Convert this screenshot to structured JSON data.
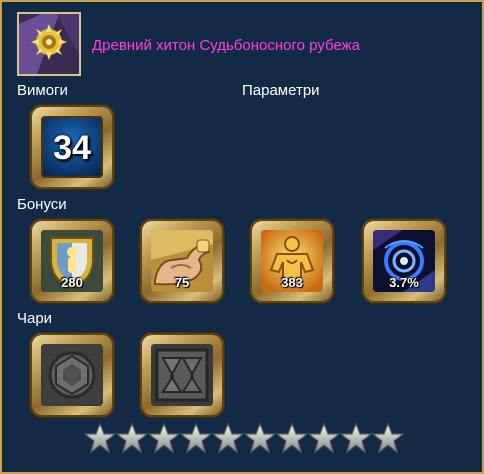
{
  "item": {
    "name": "Древний хитон Судьбоносного рубежа",
    "icon": "ancient-robe-icon"
  },
  "sections": {
    "requirements_label": "Вимоги",
    "parameters_label": "Параметри",
    "bonuses_label": "Бонуси",
    "charms_label": "Чари"
  },
  "requirement": {
    "level": "34",
    "icon": "level-requirement-icon"
  },
  "bonuses": [
    {
      "icon": "shield-defense-icon",
      "value": "280"
    },
    {
      "icon": "strength-arm-icon",
      "value": "75"
    },
    {
      "icon": "stamina-body-icon",
      "value": "383"
    },
    {
      "icon": "blue-vortex-icon",
      "value": "3.7%"
    }
  ],
  "charms": [
    {
      "icon": "empty-charm-slot-icon"
    },
    {
      "icon": "empty-charm-slot-icon"
    }
  ],
  "rating": {
    "stars_filled": 0,
    "stars_total": 10
  },
  "colors": {
    "background": "#132a47",
    "border": "#c9a44a",
    "item_name": "#ff3fe0",
    "label": "#ffffff",
    "star": "#c8c8c8"
  }
}
